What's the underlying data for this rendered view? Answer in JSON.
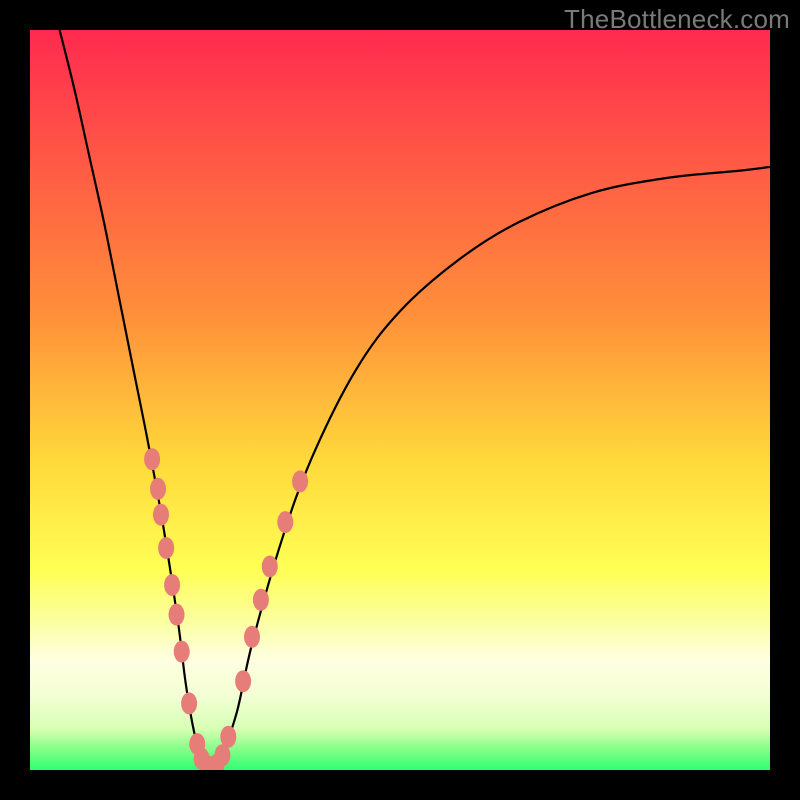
{
  "watermark": "TheBottleneck.com",
  "colors": {
    "top": "#ff2a4f",
    "mid_orange": "#ffa63a",
    "mid_yellow": "#ffe83a",
    "pale_yellow": "#ffffb0",
    "bottom_green": "#2fff74",
    "blob": "#e77d79",
    "curve": "#000000",
    "bg": "#000000"
  },
  "gradient_stops": [
    {
      "offset": 0.0,
      "color": "#ff2a4f"
    },
    {
      "offset": 0.38,
      "color": "#ff8e3a"
    },
    {
      "offset": 0.58,
      "color": "#ffd83a"
    },
    {
      "offset": 0.73,
      "color": "#ffff55"
    },
    {
      "offset": 0.8,
      "color": "#fbffa1"
    },
    {
      "offset": 0.85,
      "color": "#ffffe0"
    },
    {
      "offset": 0.9,
      "color": "#f3ffd5"
    },
    {
      "offset": 0.945,
      "color": "#d6ffb3"
    },
    {
      "offset": 0.97,
      "color": "#8bff8a"
    },
    {
      "offset": 1.0,
      "color": "#2fff74"
    }
  ],
  "chart_data": {
    "type": "line",
    "title": "",
    "xlabel": "",
    "ylabel": "",
    "xlim": [
      0,
      100
    ],
    "ylim": [
      0,
      100
    ],
    "series": [
      {
        "name": "bottleneck-curve",
        "x": [
          4,
          6,
          8,
          10,
          12,
          14,
          16,
          18,
          20,
          21,
          22,
          23,
          24,
          25,
          26,
          28,
          30,
          34,
          38,
          44,
          50,
          58,
          66,
          76,
          86,
          96,
          100
        ],
        "y": [
          100,
          92,
          83,
          74,
          64,
          54,
          44,
          33,
          20,
          12,
          6,
          2,
          0,
          0,
          2,
          8,
          17,
          31,
          42,
          54,
          62,
          69,
          74,
          78,
          80,
          81,
          81.5
        ]
      }
    ],
    "markers": {
      "name": "highlight-blobs",
      "color": "#e77d79",
      "points": [
        {
          "x": 16.5,
          "y": 42
        },
        {
          "x": 17.3,
          "y": 38
        },
        {
          "x": 17.7,
          "y": 34.5
        },
        {
          "x": 18.4,
          "y": 30
        },
        {
          "x": 19.2,
          "y": 25
        },
        {
          "x": 19.8,
          "y": 21
        },
        {
          "x": 20.5,
          "y": 16
        },
        {
          "x": 21.5,
          "y": 9
        },
        {
          "x": 22.6,
          "y": 3.5
        },
        {
          "x": 23.2,
          "y": 1.5
        },
        {
          "x": 24.0,
          "y": 0.5
        },
        {
          "x": 25.2,
          "y": 0.7
        },
        {
          "x": 26.0,
          "y": 2.0
        },
        {
          "x": 26.8,
          "y": 4.5
        },
        {
          "x": 28.8,
          "y": 12
        },
        {
          "x": 30.0,
          "y": 18
        },
        {
          "x": 31.2,
          "y": 23
        },
        {
          "x": 32.4,
          "y": 27.5
        },
        {
          "x": 34.5,
          "y": 33.5
        },
        {
          "x": 36.5,
          "y": 39
        }
      ]
    },
    "annotations": []
  }
}
